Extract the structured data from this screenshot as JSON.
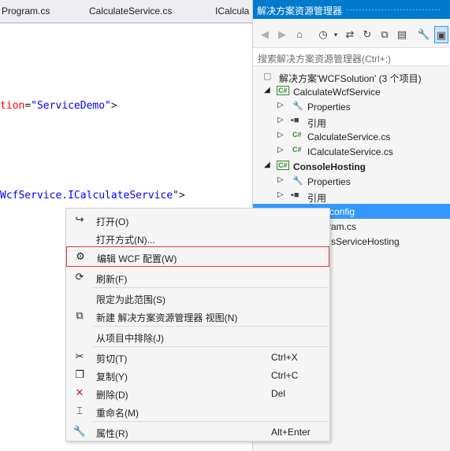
{
  "editor": {
    "tabs": [
      "Program.cs",
      "CalculateService.cs",
      "ICalcula"
    ],
    "code_lines": [
      {
        "attr": "tion",
        "eq": "=",
        "str": "\"ServiceDemo\"",
        "end": ">"
      },
      {
        "attr": "WcfService.ICalculateService",
        "str_prefix": "",
        "end": "\">"
      }
    ]
  },
  "solution_explorer": {
    "title": "解决方案资源管理器",
    "search_placeholder": "搜索解决方案资源管理器(Ctrl+;)",
    "tree": [
      {
        "label": "解决方案'WCFSolution' (3 个项目)",
        "icon": "solution-icon"
      },
      {
        "label": "CalculateWcfService",
        "icon": "csharp-project-icon"
      },
      {
        "label": "Properties",
        "icon": "wrench-icon"
      },
      {
        "label": "引用",
        "icon": "references-icon"
      },
      {
        "label": "CalculateService.cs",
        "icon": "csharp-file-icon"
      },
      {
        "label": "ICalculateService.cs",
        "icon": "csharp-file-icon"
      },
      {
        "label": "ConsoleHosting",
        "icon": "csharp-project-icon"
      },
      {
        "label": "Properties",
        "icon": "wrench-icon"
      },
      {
        "label": "引用",
        "icon": "references-icon"
      },
      {
        "label": "App.config",
        "icon": "config-file-icon"
      },
      {
        "label": "Program.cs",
        "icon": "csharp-file-icon"
      },
      {
        "label": "ClassServiceHosting",
        "icon": "csharp-file-icon"
      }
    ],
    "visible_partial": [
      "config",
      "ram.cs",
      "sServiceHosting"
    ]
  },
  "context_menu": {
    "items": [
      {
        "label": "打开(O)",
        "shortcut": "",
        "icon": "open-icon"
      },
      {
        "label": "打开方式(N)...",
        "shortcut": "",
        "icon": ""
      },
      {
        "label": "编辑 WCF 配置(W)",
        "shortcut": "",
        "icon": "wcf-config-icon"
      },
      {
        "label": "刷新(F)",
        "shortcut": "",
        "icon": "refresh-icon"
      },
      {
        "label": "限定为此范围(S)",
        "shortcut": "",
        "icon": ""
      },
      {
        "label": "新建 解决方案资源管理器 视图(N)",
        "shortcut": "",
        "icon": "new-view-icon"
      },
      {
        "label": "从项目中排除(J)",
        "shortcut": "",
        "icon": ""
      },
      {
        "label": "剪切(T)",
        "shortcut": "Ctrl+X",
        "icon": "cut-icon"
      },
      {
        "label": "复制(Y)",
        "shortcut": "Ctrl+C",
        "icon": "copy-icon"
      },
      {
        "label": "删除(D)",
        "shortcut": "Del",
        "icon": "delete-icon"
      },
      {
        "label": "重命名(M)",
        "shortcut": "",
        "icon": "rename-icon"
      },
      {
        "label": "属性(R)",
        "shortcut": "Alt+Enter",
        "icon": "properties-icon"
      }
    ]
  },
  "colors": {
    "accent": "#007acc",
    "selection": "#3399ff",
    "highlight_border": "#e0393e",
    "code_attr": "#ff0000",
    "code_string": "#0000ff",
    "delete_icon": "#cc2222"
  }
}
